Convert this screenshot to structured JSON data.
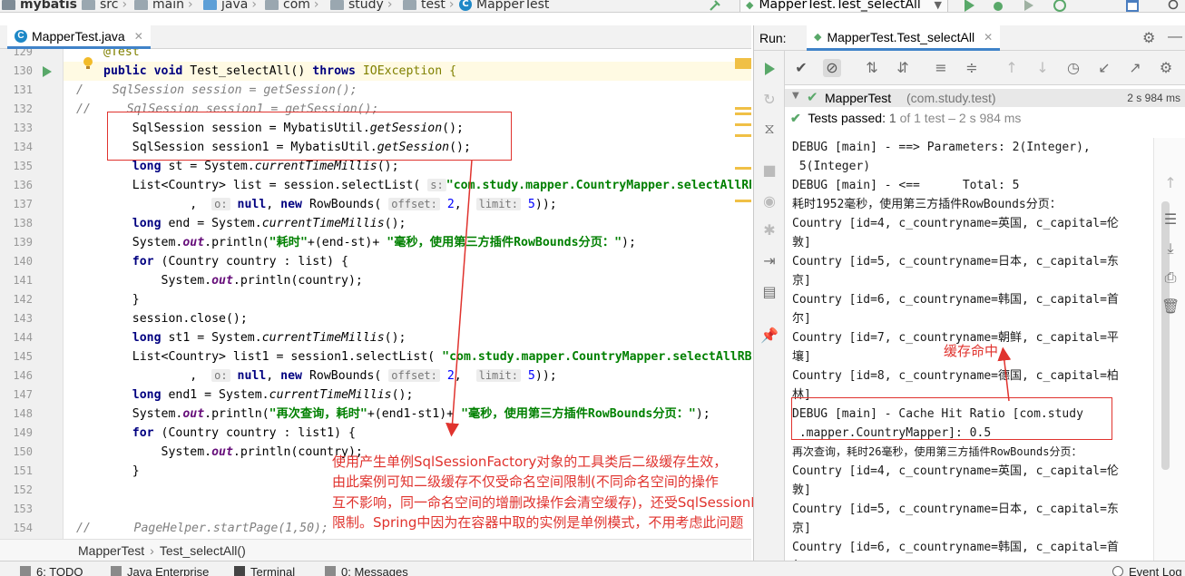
{
  "breadcrumbs": {
    "project": "mybatis",
    "items": [
      "src",
      "main",
      "java",
      "com",
      "study",
      "test"
    ],
    "current": "MapperTest"
  },
  "run_config": "MapperTest.Test_selectAll",
  "editor": {
    "tab_label": "MapperTest.java",
    "crumb_class": "MapperTest",
    "crumb_method": "Test_selectAll()",
    "line_numbers": [
      "129",
      "130",
      "131",
      "132",
      "133",
      "134",
      "135",
      "136",
      "137",
      "138",
      "139",
      "140",
      "141",
      "142",
      "143",
      "144",
      "145",
      "146",
      "147",
      "148",
      "149",
      "150",
      "151",
      "152",
      "153",
      "154"
    ],
    "l129": "@Test",
    "l130_a": "public void ",
    "l130_b": "Test_selectAll() ",
    "l130_c": "throws ",
    "l130_d": "IOException {",
    "l131": "/    SqlSession session = getSession();",
    "l132": "//     SqlSession session1 = getSession();",
    "l133_a": "    SqlSession session = MybatisUtil.",
    "l133_b": "getSession",
    "l133_c": "();",
    "l134_a": "    SqlSession session1 = MybatisUtil.",
    "l134_b": "getSession",
    "l134_c": "();",
    "l135_a": "    long ",
    "l135_b": "st = System.",
    "l135_c": "currentTimeMillis",
    "l135_d": "();",
    "l136_a": "    List<Country> list = session.selectList(",
    "l136_hint": "s:",
    "l136_b": "\"com.study.mapper.CountryMapper.selectAllRB\"",
    "l137_a": "            ,",
    "l137_hint1": "o:",
    "l137_b": "null",
    "l137_c": ", ",
    "l137_d": "new ",
    "l137_e": "RowBounds(",
    "l137_hint2": "offset:",
    "l137_f": "2",
    "l137_g": ",  ",
    "l137_hint3": "limit:",
    "l137_h": "5",
    "l137_i": "));",
    "l138_a": "    long ",
    "l138_b": "end = System.",
    "l138_c": "currentTimeMillis",
    "l138_d": "();",
    "l139_a": "    System.",
    "l139_b": "out",
    "l139_c": ".println(",
    "l139_d": "\"耗时\"",
    "l139_e": "+(end-st)+ ",
    "l139_f": "\"毫秒，使用第三方插件RowBounds分页：\"",
    "l139_g": ");",
    "l140_a": "    for ",
    "l140_b": "(Country country : list) {",
    "l141_a": "        System.",
    "l141_b": "out",
    "l141_c": ".println(country);",
    "l142": "    }",
    "l143": "    session.close();",
    "l144_a": "    long ",
    "l144_b": "st1 = System.",
    "l144_c": "currentTimeMillis",
    "l144_d": "();",
    "l145_a": "    List<Country> list1 = session1.selectList(",
    "l145_b": " \"com.study.mapper.CountryMapper.selectAllRB\"",
    "l146_a": "            ,",
    "l146_hint1": "o:",
    "l146_b": "null",
    "l146_c": ", ",
    "l146_d": "new ",
    "l146_e": "RowBounds(",
    "l146_hint2": "offset:",
    "l146_f": "2",
    "l146_g": ",  ",
    "l146_hint3": "limit:",
    "l146_h": "5",
    "l146_i": "));",
    "l147_a": "    long ",
    "l147_b": "end1 = System.",
    "l147_c": "currentTimeMillis",
    "l147_d": "();",
    "l148_a": "    System.",
    "l148_b": "out",
    "l148_c": ".println(",
    "l148_d": "\"再次查询，耗时\"",
    "l148_e": "+(end1-st1)+ ",
    "l148_f": "\"毫秒，使用第三方插件RowBounds分页：\"",
    "l148_g": ");",
    "l149_a": "    for ",
    "l149_b": "(Country country : list1) {",
    "l150_a": "        System.",
    "l150_b": "out",
    "l150_c": ".println(country);",
    "l151": "    }",
    "l154_a": "//      ",
    "l154_b": "PageHelper.startPage(1,50);"
  },
  "annotations": {
    "note_main_1": "使用产生单例SqlSessionFactory对象的工具类后二级缓存生效，",
    "note_main_2": "由此案例可知二级缓存不仅受命名空间限制(不同命名空间的操作",
    "note_main_3": "互不影响，同一命名空间的增删改操作会清空缓存)，还受SqlSessionFactory",
    "note_main_4": "限制。Spring中因为在容器中取的实例是单例模式，不用考虑此问题",
    "note_cache": "缓存命中",
    "color": "#e0332e"
  },
  "run_panel": {
    "label": "Run:",
    "tab": "MapperTest.Test_selectAll",
    "tree_root": "MapperTest",
    "tree_root_pkg": "(com.study.test)",
    "tree_root_time": "2 s 984 ms",
    "passed_label": "Tests passed:",
    "passed_count": "1",
    "passed_detail": "of 1 test – 2 s 984 ms",
    "console_lines": [
      "DEBUG [main] - ==> Parameters: 2(Integer),",
      " 5(Integer)",
      "DEBUG [main] - <==      Total: 5",
      "耗时1952毫秒，使用第三方插件RowBounds分页：",
      "Country [id=4, c_countryname=英国, c_capital=伦",
      "敦]",
      "Country [id=5, c_countryname=日本, c_capital=东",
      "京]",
      "Country [id=6, c_countryname=韩国, c_capital=首",
      "尔]",
      "Country [id=7, c_countryname=朝鲜, c_capital=平",
      "壤]",
      "Country [id=8, c_countryname=德国, c_capital=柏",
      "林]",
      "DEBUG [main] - Cache Hit Ratio [com.study",
      " .mapper.CountryMapper]: 0.5",
      "再次查询，耗时26毫秒，使用第三方插件RowBounds分页：",
      "Country [id=4, c_countryname=英国, c_capital=伦",
      "敦]",
      "Country [id=5, c_countryname=日本, c_capital=东",
      "京]",
      "Country [id=6, c_countryname=韩国, c_capital=首",
      "尔]"
    ]
  },
  "bottom_bar": {
    "todo": "6: TODO",
    "java_enterprise": "Java Enterprise",
    "terminal": "Terminal",
    "messages": "0: Messages",
    "event_log": "Event Log"
  },
  "colors": {
    "pass_green": "#59a869",
    "keyword": "#000080",
    "string": "#008000",
    "accent": "#4083c9"
  }
}
